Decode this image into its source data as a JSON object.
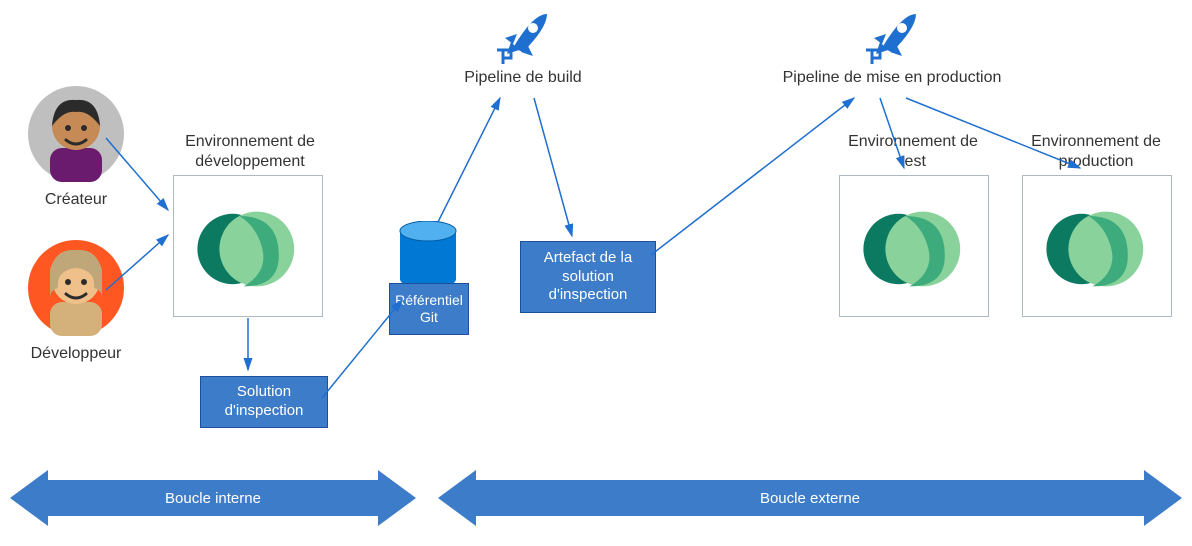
{
  "personas": {
    "creator": "Créateur",
    "developer": "Développeur"
  },
  "environments": {
    "dev": "Environnement de développement",
    "test": "Environnement de test",
    "prod": "Environnement de production"
  },
  "pipelines": {
    "build": "Pipeline de build",
    "release": "Pipeline de mise en production"
  },
  "boxes": {
    "inspection_solution": "Solution d'inspection",
    "git_repo": "Référentiel Git",
    "artifact": "Artefact de la solution d'inspection"
  },
  "loops": {
    "inner": "Boucle interne",
    "outer": "Boucle externe"
  },
  "colors": {
    "primary_blue": "#3d7cc9",
    "arrow_blue": "#1f6fd0",
    "grey_border": "#aeb9c4",
    "avatar1_bg": "#bfbfbf",
    "avatar2_bg": "#ff5722",
    "dataverse_dark": "#0b7a60",
    "dataverse_mid": "#3dab7b",
    "dataverse_light": "#8ad29c",
    "rocket_blue": "#1f6fd0",
    "db_blue": "#0078d4"
  }
}
